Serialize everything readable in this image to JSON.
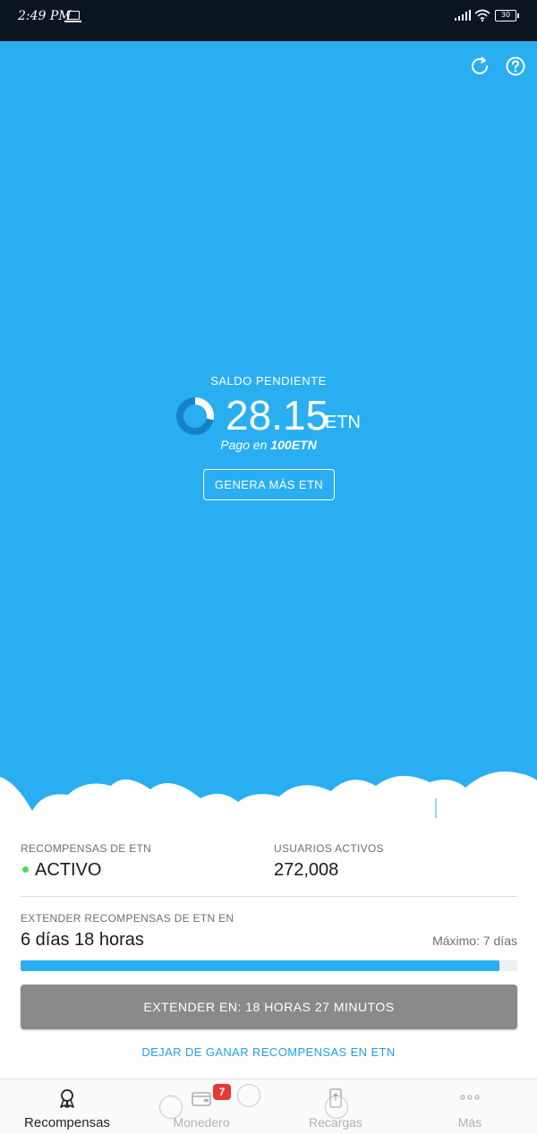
{
  "status_bar": {
    "time": "2:49 PM",
    "battery": "30"
  },
  "hero": {
    "balance_label": "SALDO PENDIENTE",
    "balance_value": "28.15",
    "balance_unit": "ETN",
    "payout_prefix": "Pago en",
    "payout_amount": "100ETN",
    "payout_progress": 0.2815,
    "earn_more_label": "GENERA MÁS ETN",
    "background_color": "#29aef2"
  },
  "info": {
    "rewards_label": "RECOMPENSAS DE ETN",
    "rewards_status": "ACTIVO",
    "active_users_label": "USUARIOS ACTIVOS",
    "active_users_value": "272,008",
    "extend_label": "EXTENDER RECOMPENSAS DE ETN EN",
    "extend_value": "6 días 18 horas",
    "max_label": "Máximo: 7 días",
    "extend_progress": 0.964,
    "extend_button": "EXTENDER EN: 18 HORAS 27 MINUTOS",
    "stop_link": "DEJAR DE GANAR RECOMPENSAS EN ETN"
  },
  "bottom_nav": {
    "items": [
      {
        "label": "Recompensas",
        "icon": "ribbon-icon",
        "active": true
      },
      {
        "label": "Monedero",
        "icon": "wallet-icon",
        "badge": "7"
      },
      {
        "label": "Recargas",
        "icon": "phone-topup-icon"
      },
      {
        "label": "Más",
        "icon": "more-dots-icon"
      }
    ]
  }
}
